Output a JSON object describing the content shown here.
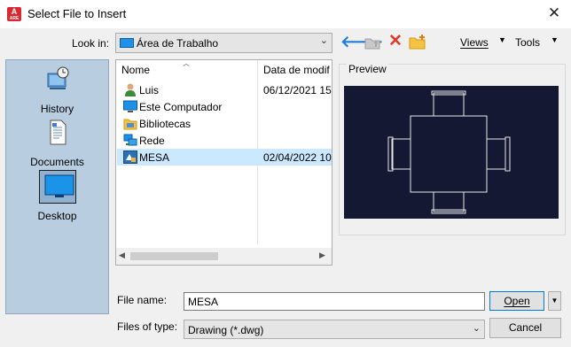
{
  "window": {
    "title": "Select File to Insert",
    "app_icon_letter": "A",
    "app_icon_sub": "ARE",
    "close_glyph": "✕"
  },
  "toolbar": {
    "look_in_label": "Look in:",
    "look_in_value": "Área de Trabalho",
    "views_label": "Views",
    "tools_label": "Tools",
    "back_glyph": "🡐",
    "delete_glyph": "✕",
    "dropdown_glyph": "▼",
    "chevron_glyph": "⌄"
  },
  "places": [
    {
      "label": "History",
      "icon": "history-icon"
    },
    {
      "label": "Documents",
      "icon": "documents-icon"
    },
    {
      "label": "Desktop",
      "icon": "desktop-icon"
    }
  ],
  "file_list": {
    "columns": {
      "name": "Nome",
      "date": "Data de modif"
    },
    "rows": [
      {
        "name": "Luis",
        "date": "06/12/2021 15:",
        "icon": "user-folder-icon"
      },
      {
        "name": "Este Computador",
        "date": "",
        "icon": "computer-icon"
      },
      {
        "name": "Bibliotecas",
        "date": "",
        "icon": "libraries-icon"
      },
      {
        "name": "Rede",
        "date": "",
        "icon": "network-icon"
      },
      {
        "name": "MESA",
        "date": "02/04/2022 10:",
        "icon": "dwg-file-icon",
        "selected": true
      }
    ]
  },
  "preview": {
    "label": "Preview"
  },
  "bottom": {
    "file_name_label": "File name:",
    "file_name_value": "MESA",
    "file_type_label": "Files of type:",
    "file_type_value": "Drawing (*.dwg)",
    "open_label": "Open",
    "cancel_label": "Cancel"
  },
  "colors": {
    "places_bg": "#b9cde0",
    "selection": "#cce8ff",
    "preview_bg": "#141833",
    "accent": "#0078d7"
  }
}
